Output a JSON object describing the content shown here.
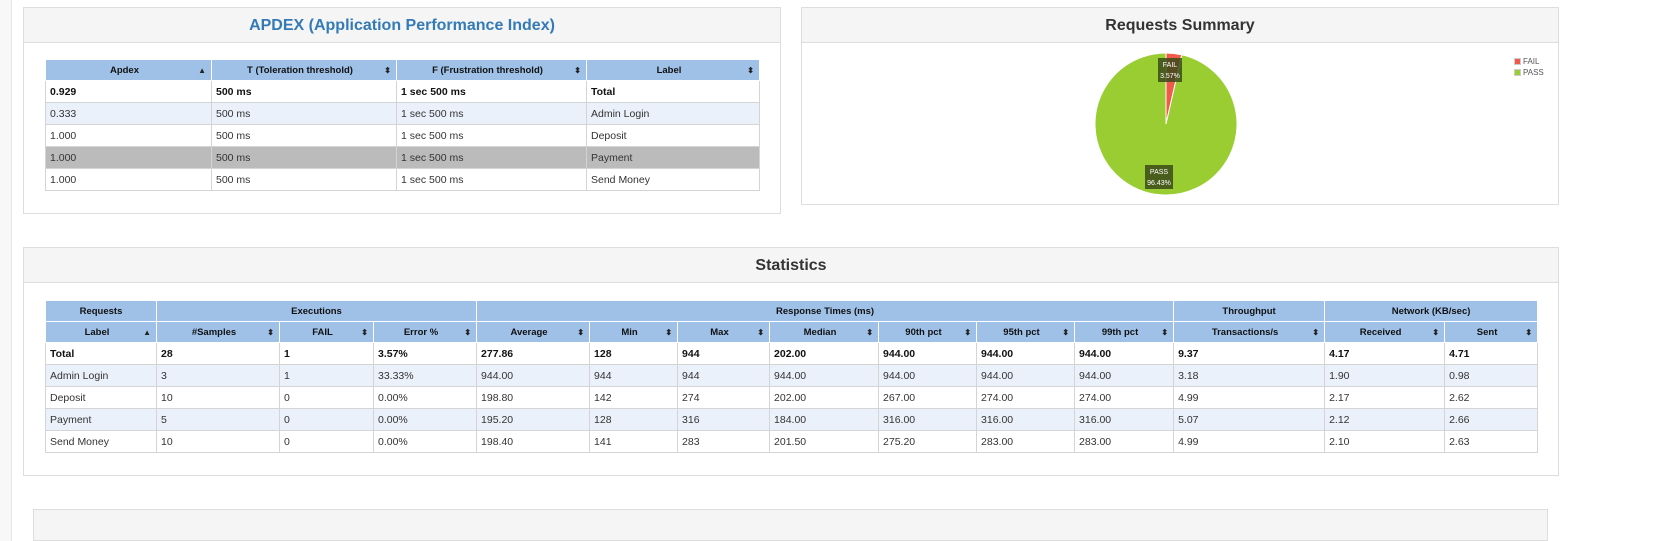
{
  "apdex": {
    "title": "APDEX (Application Performance Index)",
    "headers": [
      "Apdex",
      "T (Toleration threshold)",
      "F (Frustration threshold)",
      "Label"
    ],
    "rows": [
      [
        "0.929",
        "500 ms",
        "1 sec 500 ms",
        "Total"
      ],
      [
        "0.333",
        "500 ms",
        "1 sec 500 ms",
        "Admin Login"
      ],
      [
        "1.000",
        "500 ms",
        "1 sec 500 ms",
        "Deposit"
      ],
      [
        "1.000",
        "500 ms",
        "1 sec 500 ms",
        "Payment"
      ],
      [
        "1.000",
        "500 ms",
        "1 sec 500 ms",
        "Send Money"
      ]
    ]
  },
  "summary": {
    "title": "Requests Summary",
    "fail_label": "FAIL",
    "fail_pct": "3.57%",
    "pass_label": "PASS",
    "pass_pct": "96.43%",
    "fail_color": "#f05a4a",
    "pass_color": "#9acd32"
  },
  "chart_data": {
    "type": "pie",
    "categories": [
      "FAIL",
      "PASS"
    ],
    "values": [
      3.57,
      96.43
    ],
    "colors": [
      "#f05a4a",
      "#9acd32"
    ],
    "legend_position": "top-right"
  },
  "statistics": {
    "title": "Statistics",
    "groups": [
      "Requests",
      "Executions",
      "Response Times (ms)",
      "Throughput",
      "Network (KB/sec)"
    ],
    "headers": [
      "Label",
      "#Samples",
      "FAIL",
      "Error %",
      "Average",
      "Min",
      "Max",
      "Median",
      "90th pct",
      "95th pct",
      "99th pct",
      "Transactions/s",
      "Received",
      "Sent"
    ],
    "rows": [
      [
        "Total",
        "28",
        "1",
        "3.57%",
        "277.86",
        "128",
        "944",
        "202.00",
        "944.00",
        "944.00",
        "944.00",
        "9.37",
        "4.17",
        "4.71"
      ],
      [
        "Admin Login",
        "3",
        "1",
        "33.33%",
        "944.00",
        "944",
        "944",
        "944.00",
        "944.00",
        "944.00",
        "944.00",
        "3.18",
        "1.90",
        "0.98"
      ],
      [
        "Deposit",
        "10",
        "0",
        "0.00%",
        "198.80",
        "142",
        "274",
        "202.00",
        "267.00",
        "274.00",
        "274.00",
        "4.99",
        "2.17",
        "2.62"
      ],
      [
        "Payment",
        "5",
        "0",
        "0.00%",
        "195.20",
        "128",
        "316",
        "184.00",
        "316.00",
        "316.00",
        "316.00",
        "5.07",
        "2.12",
        "2.66"
      ],
      [
        "Send Money",
        "10",
        "0",
        "0.00%",
        "198.40",
        "141",
        "283",
        "201.50",
        "275.20",
        "283.00",
        "283.00",
        "4.99",
        "2.10",
        "2.63"
      ]
    ]
  }
}
